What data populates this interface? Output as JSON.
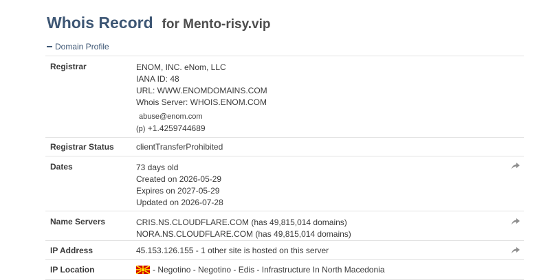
{
  "header": {
    "title": "Whois Record",
    "subtitle": "for Mento-risy.vip"
  },
  "section": {
    "label": "Domain Profile",
    "toggle_icon": "minus-icon"
  },
  "registrar": {
    "label": "Registrar",
    "name": "ENOM, INC. eNom, LLC",
    "iana": "IANA ID: 48",
    "url": "URL: WWW.ENOMDOMAINS.COM",
    "whois_server": "Whois Server: WHOIS.ENOM.COM",
    "email": "abuse@enom.com",
    "phone_prefix": "(p)",
    "phone": "+1.4259744689"
  },
  "registrar_status": {
    "label": "Registrar Status",
    "value": "clientTransferProhibited"
  },
  "dates": {
    "label": "Dates",
    "age": "73 days old",
    "created": "Created on 2026-05-29",
    "expires": "Expires on 2027-05-29",
    "updated": "Updated on 2026-07-28"
  },
  "name_servers": {
    "label": "Name Servers",
    "ns1": "CRIS.NS.CLOUDFLARE.COM (has 49,815,014 domains)",
    "ns2": "NORA.NS.CLOUDFLARE.COM (has 49,815,014 domains)"
  },
  "ip_address": {
    "label": "IP Address",
    "value": "45.153.126.155 - 1 other site is hosted on this server"
  },
  "ip_location": {
    "label": "IP Location",
    "flag_icon": "north-macedonia-flag-icon",
    "value": "- Negotino - Negotino - Edis - Infrastructure In North Macedonia"
  },
  "colors": {
    "title": "#3d5674",
    "text": "#3a3a3a",
    "border": "#e3e3e3",
    "share_icon": "#8f8f8f",
    "flag_red": "#d20000",
    "flag_yellow": "#ffe600"
  }
}
